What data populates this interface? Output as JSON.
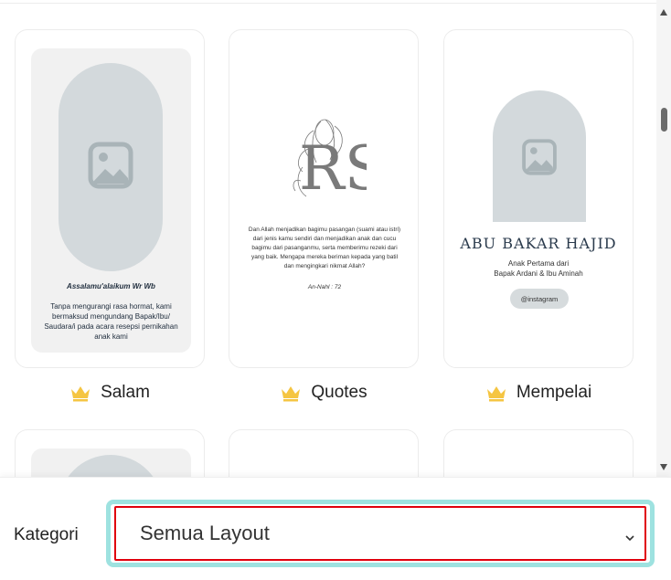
{
  "templates": [
    {
      "label": "Salam",
      "icon": "crown-icon",
      "preview": {
        "greeting": "Assalamu'alaikum Wr Wb",
        "body": "Tanpa mengurangi rasa hormat, kami bermaksud mengundang Bapak/Ibu/ Saudara/i pada acara resepsi pernikahan anak kami"
      }
    },
    {
      "label": "Quotes",
      "icon": "crown-icon",
      "preview": {
        "monogram": "RS",
        "quote": "Dan Allah menjadikan bagimu pasangan (suami atau istri) dari jenis kamu sendiri dan menjadikan anak dan cucu bagimu dari pasanganmu, serta memberimu rezeki dari yang baik. Mengapa mereka beriman kepada yang batil dan mengingkari nikmat Allah?",
        "source": "An-Nahl : 72"
      }
    },
    {
      "label": "Mempelai",
      "icon": "crown-icon",
      "preview": {
        "name": "ABU BAKAR HAJID",
        "line1": "Anak Pertama dari",
        "line2": "Bapak Ardani & Ibu Aminah",
        "instagram": "@instagram"
      }
    }
  ],
  "filter": {
    "label": "Kategori",
    "selected": "Semua Layout"
  },
  "colors": {
    "crown": "#f5c542",
    "placeholder": "#d3d9dc",
    "focus_ring": "#9ee2e0",
    "highlight": "#e0000d"
  }
}
